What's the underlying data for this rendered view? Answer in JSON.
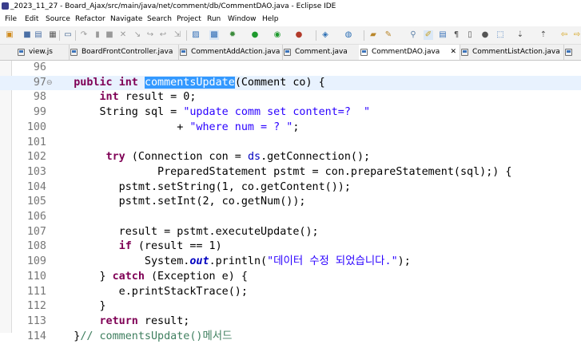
{
  "window": {
    "title": "_2023_11_27 - Board_Ajax/src/main/java/net/comment/db/CommentDAO.java - Eclipse IDE"
  },
  "menu": [
    "File",
    "Edit",
    "Source",
    "Refactor",
    "Navigate",
    "Search",
    "Project",
    "Run",
    "Window",
    "Help"
  ],
  "tabs": [
    {
      "label": "view.js",
      "active": false
    },
    {
      "label": "BoardFrontController.java",
      "active": false
    },
    {
      "label": "CommentAddAction.java",
      "active": false
    },
    {
      "label": "Comment.java",
      "active": false
    },
    {
      "label": "CommentDAO.java",
      "active": true,
      "close": "✕"
    },
    {
      "label": "CommentListAction.java",
      "active": false
    }
  ],
  "editor": {
    "current_line": "97",
    "lines": [
      {
        "num": "96",
        "tokens": []
      },
      {
        "num": "97",
        "fold": "⊖",
        "tokens": [
          {
            "t": "    "
          },
          {
            "t": "public",
            "c": "kw"
          },
          {
            "t": " "
          },
          {
            "t": "int",
            "c": "kw"
          },
          {
            "t": " "
          },
          {
            "t": "commentsUpdate",
            "c": "sel"
          },
          {
            "t": "(Comment co) {"
          }
        ]
      },
      {
        "num": "98",
        "tokens": [
          {
            "t": "        "
          },
          {
            "t": "int",
            "c": "kw"
          },
          {
            "t": " result = 0;"
          }
        ]
      },
      {
        "num": "99",
        "tokens": [
          {
            "t": "        String sql = "
          },
          {
            "t": "\"update comm set content=?  \"",
            "c": "str"
          }
        ]
      },
      {
        "num": "100",
        "tokens": [
          {
            "t": "                    + "
          },
          {
            "t": "\"where num = ? \"",
            "c": "str"
          },
          {
            "t": ";"
          }
        ]
      },
      {
        "num": "101",
        "tokens": []
      },
      {
        "num": "102",
        "tokens": [
          {
            "t": "         "
          },
          {
            "t": "try",
            "c": "kw"
          },
          {
            "t": " (Connection con = "
          },
          {
            "t": "ds",
            "c": "fld"
          },
          {
            "t": ".getConnection();"
          }
        ]
      },
      {
        "num": "103",
        "tokens": [
          {
            "t": "                 PreparedStatement pstmt = con.prepareStatement(sql);) {"
          }
        ]
      },
      {
        "num": "104",
        "tokens": [
          {
            "t": "           pstmt.setString(1, co.getContent());"
          }
        ]
      },
      {
        "num": "105",
        "tokens": [
          {
            "t": "           pstmt.setInt(2, co.getNum());"
          }
        ]
      },
      {
        "num": "106",
        "tokens": []
      },
      {
        "num": "107",
        "tokens": [
          {
            "t": "           result = pstmt.executeUpdate();"
          }
        ]
      },
      {
        "num": "108",
        "tokens": [
          {
            "t": "           "
          },
          {
            "t": "if",
            "c": "kw"
          },
          {
            "t": " (result == 1)"
          }
        ]
      },
      {
        "num": "109",
        "tokens": [
          {
            "t": "               System."
          },
          {
            "t": "out",
            "c": "fi"
          },
          {
            "t": ".println("
          },
          {
            "t": "\"데이터 수정 되었습니다.\"",
            "c": "str"
          },
          {
            "t": ");"
          }
        ]
      },
      {
        "num": "110",
        "tokens": [
          {
            "t": "        } "
          },
          {
            "t": "catch",
            "c": "kw"
          },
          {
            "t": " (Exception e) {"
          }
        ]
      },
      {
        "num": "111",
        "tokens": [
          {
            "t": "           e.printStackTrace();"
          }
        ]
      },
      {
        "num": "112",
        "tokens": [
          {
            "t": "        }"
          }
        ]
      },
      {
        "num": "113",
        "tokens": [
          {
            "t": "        "
          },
          {
            "t": "return",
            "c": "kw"
          },
          {
            "t": " result;"
          }
        ]
      },
      {
        "num": "114",
        "tokens": [
          {
            "t": "    }"
          },
          {
            "t": "// commentsUpdate()메서드",
            "c": "cm"
          }
        ]
      }
    ]
  },
  "colors": {
    "keyword": "#7f0055",
    "string": "#2a00ff",
    "comment": "#3f7f5f",
    "field": "#0000c0",
    "selection": "#3399ff",
    "current_line": "#e8f2fe"
  },
  "toolbar_icons": [
    "new-icon",
    "save-icon",
    "save-all-icon",
    "print-icon",
    "terminal-icon",
    "skip-icon",
    "suspend-icon",
    "stop-icon",
    "disconnect-icon",
    "step-into-icon",
    "step-over-icon",
    "step-return-icon",
    "debug-icon",
    "run-icon",
    "coverage-icon",
    "external-tools-icon",
    "new-java-icon",
    "new-package-icon",
    "open-type-icon",
    "search-icon",
    "annotation-icon",
    "highlight-icon",
    "nav-back-icon",
    "nav-forward-icon"
  ]
}
